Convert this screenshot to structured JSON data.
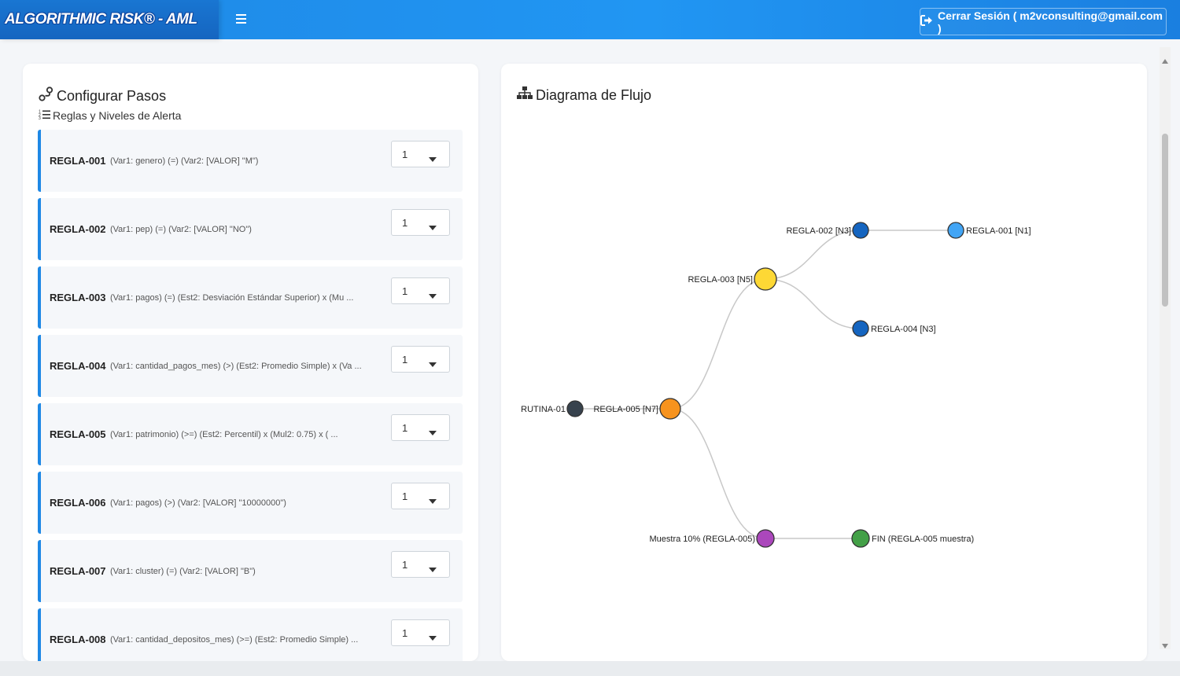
{
  "header": {
    "brand": "ALGORITHMIC RISK® - AML",
    "logout_label": "Cerrar Sesión ( m2vconsulting@gmail.com )",
    "icons": {
      "menu": "hamburger-icon",
      "logout": "sign-out-icon"
    }
  },
  "config": {
    "title": "Configurar Pasos",
    "subtitle": "Reglas y Niveles de Alerta",
    "rules": [
      {
        "code": "REGLA-001",
        "desc": "(Var1: genero) (=) (Var2: [VALOR] \"M\")",
        "level": "1"
      },
      {
        "code": "REGLA-002",
        "desc": "(Var1: pep) (=) (Var2: [VALOR] \"NO\")",
        "level": "1"
      },
      {
        "code": "REGLA-003",
        "desc": "(Var1: pagos) (=) (Est2: Desviación Estándar Superior) x (Mu ...",
        "level": "1"
      },
      {
        "code": "REGLA-004",
        "desc": "(Var1: cantidad_pagos_mes) (>) (Est2: Promedio Simple) x (Va ...",
        "level": "1"
      },
      {
        "code": "REGLA-005",
        "desc": "(Var1: patrimonio) (>=) (Est2: Percentil) x (Mul2: 0.75) x ( ...",
        "level": "1"
      },
      {
        "code": "REGLA-006",
        "desc": "(Var1: pagos) (>) (Var2: [VALOR] \"10000000\")",
        "level": "1"
      },
      {
        "code": "REGLA-007",
        "desc": "(Var1: cluster) (=) (Var2: [VALOR] \"B\")",
        "level": "1"
      },
      {
        "code": "REGLA-008",
        "desc": "(Var1: cantidad_depositos_mes) (>=) (Est2: Promedio Simple) ...",
        "level": "1"
      }
    ]
  },
  "flow": {
    "title": "Diagrama de Flujo",
    "nodes": [
      {
        "id": "rutina",
        "label": "RUTINA-01",
        "color": "#37424d"
      },
      {
        "id": "r005",
        "label": "REGLA-005 [N7]",
        "color": "#f7931e"
      },
      {
        "id": "r003",
        "label": "REGLA-003 [N5]",
        "color": "#fdd835"
      },
      {
        "id": "r002",
        "label": "REGLA-002 [N3]",
        "color": "#1565c0"
      },
      {
        "id": "r001",
        "label": "REGLA-001 [N1]",
        "color": "#42a5f5"
      },
      {
        "id": "r004",
        "label": "REGLA-004 [N3]",
        "color": "#1565c0"
      },
      {
        "id": "muestra",
        "label": "Muestra 10% (REGLA-005)",
        "color": "#ab47bc"
      },
      {
        "id": "fin",
        "label": "FIN (REGLA-005 muestra)",
        "color": "#43a047"
      }
    ],
    "edges": [
      [
        "rutina",
        "r005"
      ],
      [
        "r005",
        "r003"
      ],
      [
        "r003",
        "r002"
      ],
      [
        "r002",
        "r001"
      ],
      [
        "r003",
        "r004"
      ],
      [
        "r005",
        "muestra"
      ],
      [
        "muestra",
        "fin"
      ]
    ]
  }
}
